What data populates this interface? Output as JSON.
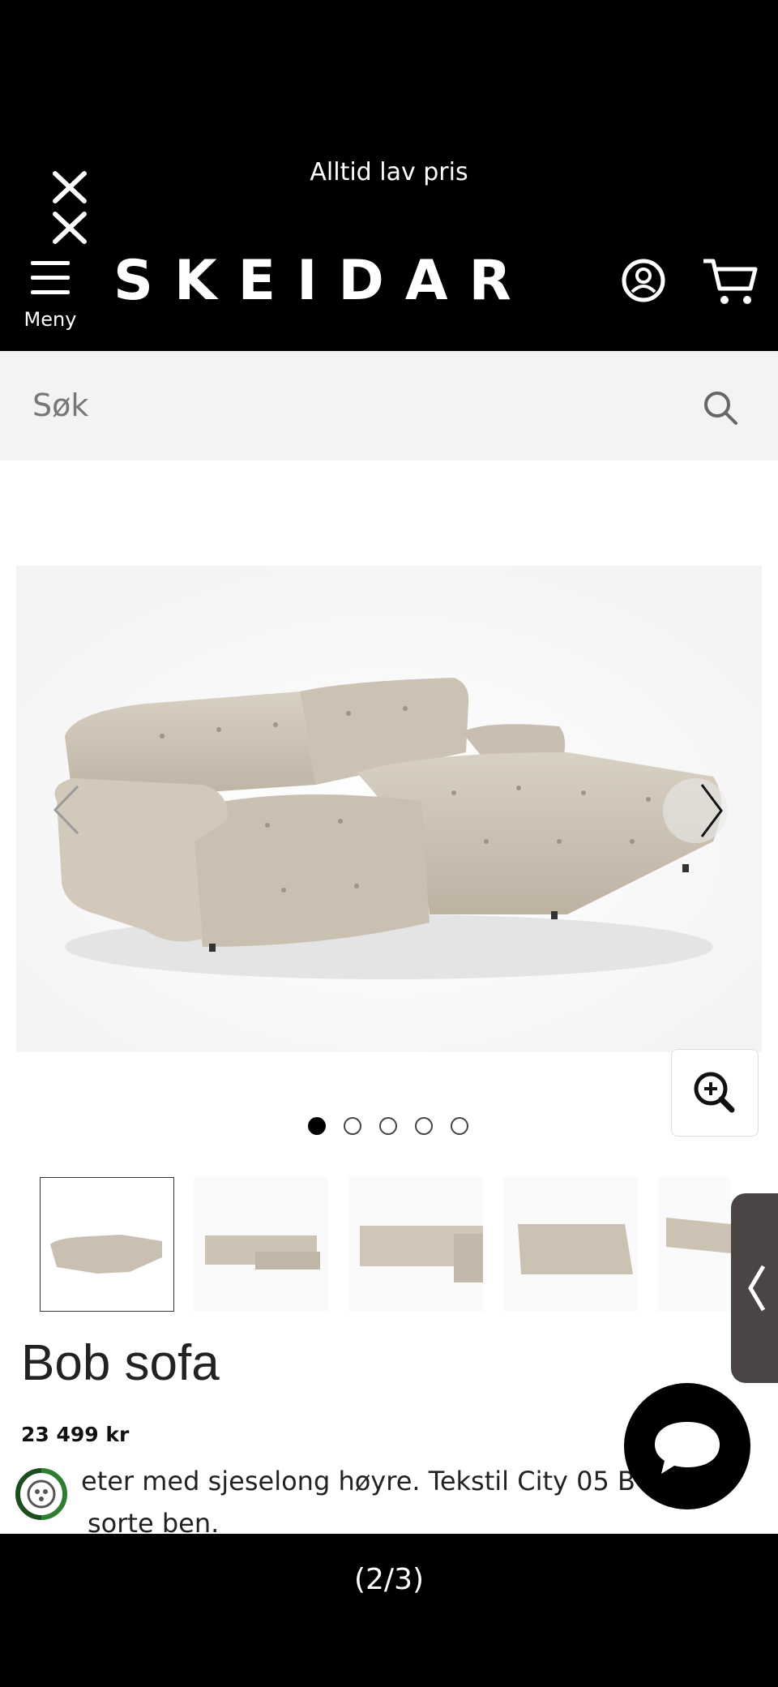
{
  "header": {
    "promo_text": "Alltid lav pris",
    "menu_label": "Meny",
    "logo_text": "SKEIDAR",
    "icons": [
      "close-icon",
      "hamburger-icon",
      "account-icon",
      "cart-icon"
    ]
  },
  "search": {
    "placeholder": "Søk",
    "icon": "search-icon"
  },
  "gallery": {
    "dots_total": 5,
    "active_dot": 1,
    "thumbnails_count": 5,
    "active_thumbnail": 1
  },
  "product": {
    "title": "Bob sofa",
    "price": "23 499 kr",
    "description_line1": "eter med sjeselong høyre. Tekstil City 05 B",
    "description_line2": "sorte ben."
  },
  "footer": {
    "counter": "(2/3)"
  },
  "colors": {
    "header_bg": "#000000",
    "search_bg": "#f3f3f3",
    "sofa": "#cfc6b8"
  }
}
